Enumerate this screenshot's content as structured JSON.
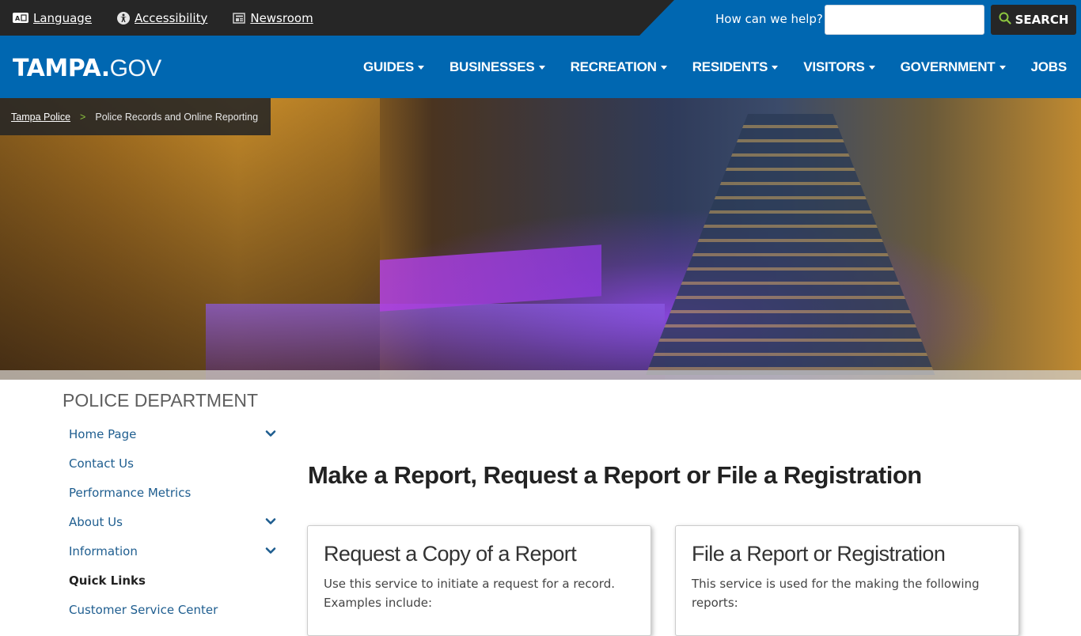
{
  "utility_bar": {
    "links": [
      {
        "label": "Language",
        "icon": "language-icon"
      },
      {
        "label": "Accessibility",
        "icon": "accessibility-icon"
      },
      {
        "label": "Newsroom",
        "icon": "newsroom-icon"
      }
    ],
    "search": {
      "label": "How can we help?",
      "value": "",
      "placeholder": "",
      "button_label": "SEARCH",
      "button_icon": "search-icon"
    }
  },
  "header": {
    "logo_bold": "TAMPA.",
    "logo_light": "GOV",
    "nav": [
      {
        "label": "GUIDES",
        "has_dropdown": true
      },
      {
        "label": "BUSINESSES",
        "has_dropdown": true
      },
      {
        "label": "RECREATION",
        "has_dropdown": true
      },
      {
        "label": "RESIDENTS",
        "has_dropdown": true
      },
      {
        "label": "VISITORS",
        "has_dropdown": true
      },
      {
        "label": "GOVERNMENT",
        "has_dropdown": true
      },
      {
        "label": "JOBS",
        "has_dropdown": false
      }
    ]
  },
  "breadcrumb": {
    "parent": "Tampa Police",
    "separator": ">",
    "current": "Police Records and Online Reporting"
  },
  "sidebar": {
    "title": "POLICE DEPARTMENT",
    "items": [
      {
        "label": "Home Page",
        "expandable": true
      },
      {
        "label": "Contact Us",
        "expandable": false
      },
      {
        "label": "Performance Metrics",
        "expandable": false
      },
      {
        "label": "About Us",
        "expandable": true
      },
      {
        "label": "Information",
        "expandable": true
      },
      {
        "label": "Quick Links",
        "heading": true
      },
      {
        "label": "Customer Service Center",
        "expandable": false
      }
    ]
  },
  "main": {
    "title": "Make a Report, Request a Report or File a Registration",
    "cards": [
      {
        "title": "Request a Copy of a Report",
        "text": "Use this service to initiate a request for a record. Examples include:"
      },
      {
        "title": "File a Report or Registration",
        "text": "This service is used for the making the following reports:"
      }
    ]
  },
  "colors": {
    "brand_blue": "#0067b1",
    "dark_bar": "#262626",
    "search_icon_green": "#8dc63f",
    "sidebar_link": "#1e5d8f"
  }
}
